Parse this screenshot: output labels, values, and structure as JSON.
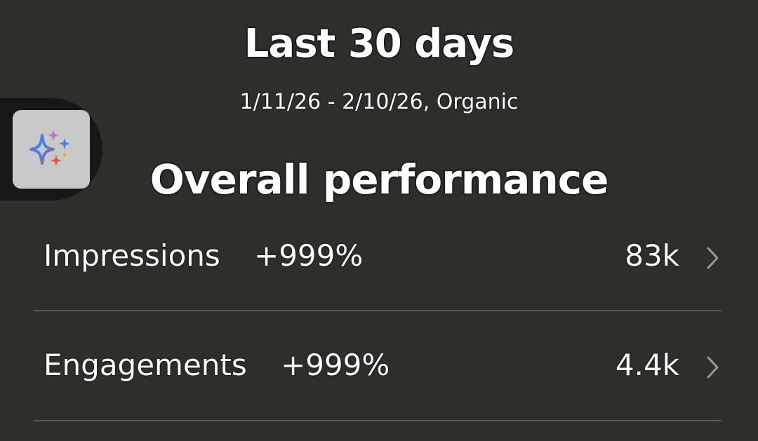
{
  "header": {
    "title": "Last 30 days",
    "date_range": "1/11/26 - 2/10/26, Organic"
  },
  "assistant_button": {
    "icon": "sparkles-icon"
  },
  "section": {
    "title": "Overall performance"
  },
  "metrics": [
    {
      "name": "Impressions",
      "change": "+999%",
      "value": "83k",
      "icon": "chevron-right-icon"
    },
    {
      "name": "Engagements",
      "change": "+999%",
      "value": "4.4k",
      "icon": "chevron-right-icon"
    }
  ],
  "colors": {
    "background": "#2f2e2b",
    "text": "#ffffff",
    "divider": "#5c5b57",
    "fab_background": "#c9c9c9",
    "sparkle_blue": "#4a7ee8",
    "sparkle_red": "#e8554a",
    "sparkle_purple": "#b07ad8"
  }
}
